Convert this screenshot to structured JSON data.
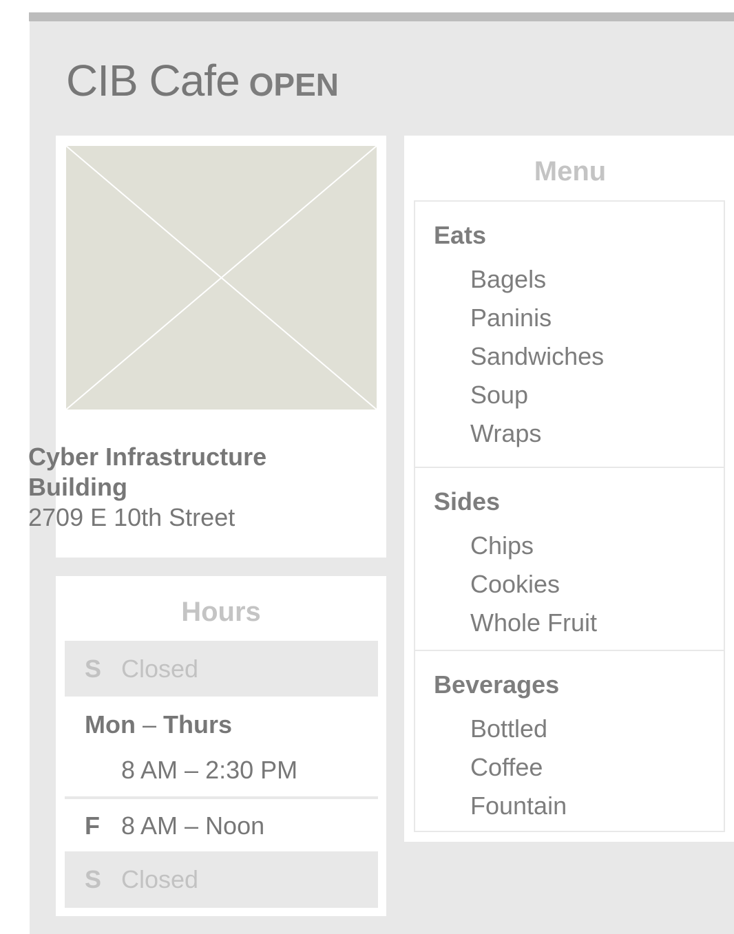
{
  "header": {
    "name": "CIB Cafe",
    "status": "OPEN"
  },
  "location": {
    "name": "Cyber Infrastructure Building",
    "address": "2709 E 10th Street"
  },
  "hours": {
    "heading": "Hours",
    "rows": [
      {
        "day": "S",
        "time": "Closed"
      },
      {
        "day_start": "Mon",
        "dash": "–",
        "day_end": "Thurs",
        "time": "8 AM – 2:30 PM"
      },
      {
        "day": "F",
        "time": "8 AM – Noon"
      },
      {
        "day": "S",
        "time": "Closed"
      }
    ]
  },
  "menu": {
    "heading": "Menu",
    "sections": [
      {
        "title": "Eats",
        "items": [
          "Bagels",
          "Paninis",
          "Sandwiches",
          "Soup",
          "Wraps"
        ]
      },
      {
        "title": "Sides",
        "items": [
          "Chips",
          "Cookies",
          "Whole Fruit"
        ]
      },
      {
        "title": "Beverages",
        "items": [
          "Bottled",
          "Coffee",
          "Fountain"
        ]
      }
    ]
  }
}
